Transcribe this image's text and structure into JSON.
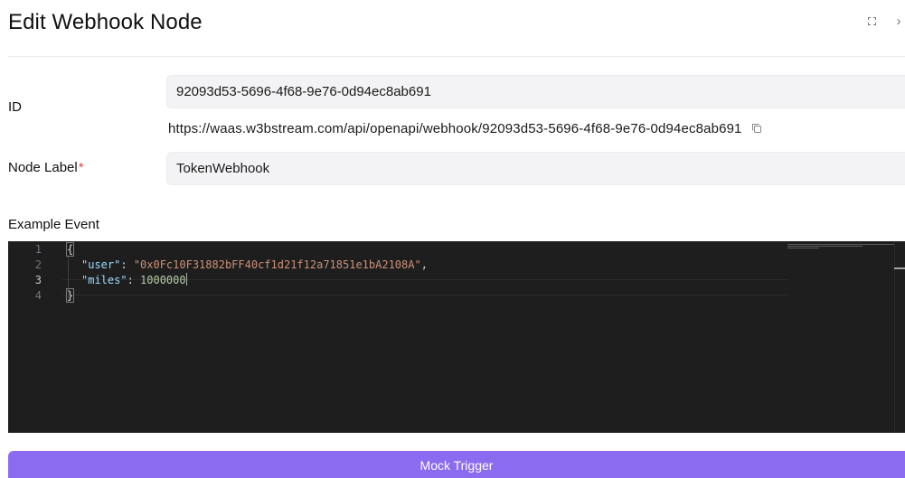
{
  "header": {
    "title": "Edit Webhook Node",
    "expand_icon": "expand-icon",
    "close_icon": "chevron-right-icon",
    "close_glyph": "›"
  },
  "form": {
    "id_label": "ID",
    "id_value": "92093d53-5696-4f68-9e76-0d94ec8ab691",
    "webhook_url": "https://waas.w3bstream.com/api/openapi/webhook/92093d53-5696-4f68-9e76-0d94ec8ab691",
    "copy_icon": "copy-icon",
    "node_label_label": "Node Label",
    "required_mark": "*",
    "node_label_value": "TokenWebhook"
  },
  "example_event": {
    "title": "Example Event",
    "line_numbers": [
      "1",
      "2",
      "3",
      "4"
    ],
    "active_line": "3",
    "lines": {
      "open": "{",
      "user_key": "\"user\"",
      "user_sep": ": ",
      "user_value": "\"0x0Fc10F31882bFF40cf1d21f12a71851e1bA2108A\"",
      "user_trail": ",",
      "miles_key": "\"miles\"",
      "miles_sep": ": ",
      "miles_value": "1000000",
      "close": "}"
    }
  },
  "actions": {
    "mock_trigger_label": "Mock Trigger"
  },
  "colors": {
    "accent": "#8b6cf0",
    "editor_bg": "#1e1e1e",
    "required": "#e5484d"
  }
}
